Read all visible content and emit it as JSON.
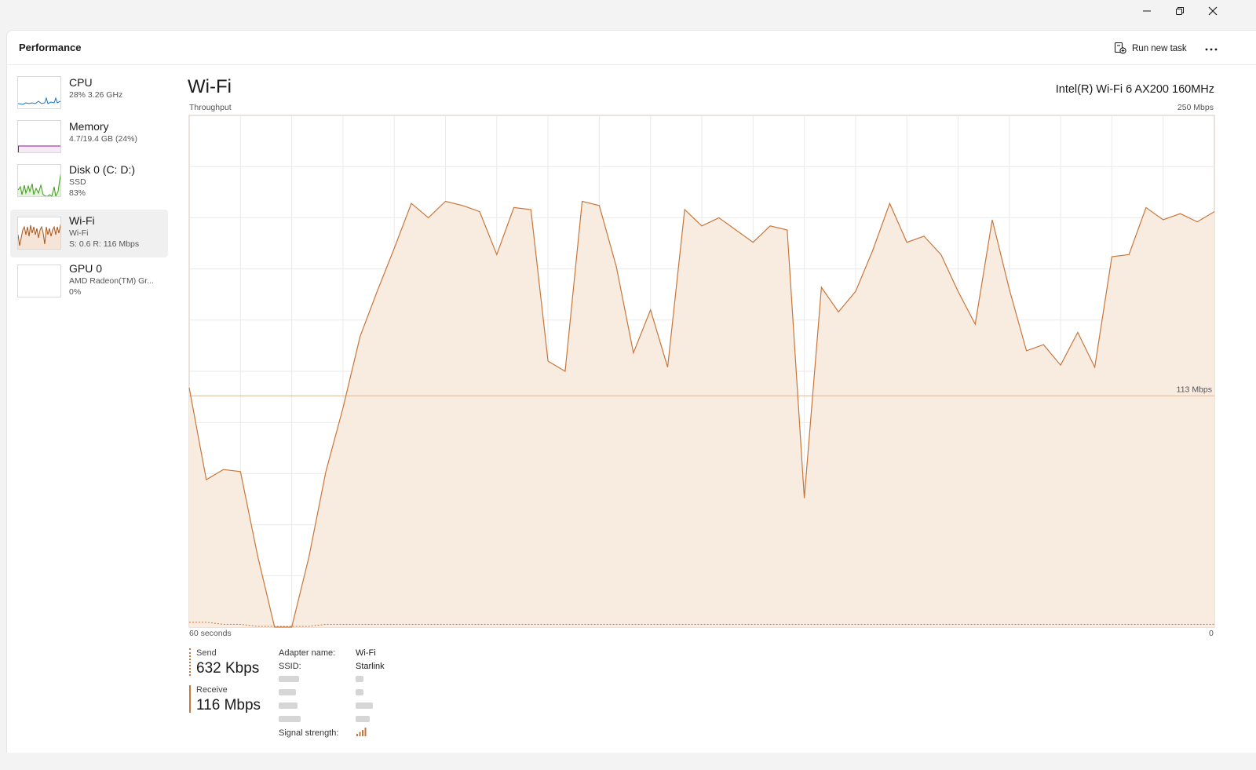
{
  "window": {
    "controls": {
      "minimize_icon": "minimize-icon",
      "maximize_icon": "restore-icon",
      "close_icon": "close-icon"
    }
  },
  "header": {
    "title": "Performance",
    "run_new_task": "Run new task",
    "more_icon": "more-icon"
  },
  "sidebar": {
    "items": [
      {
        "name": "CPU",
        "sub1": "28%  3.26 GHz",
        "sub2": "",
        "color": "#1a73c7"
      },
      {
        "name": "Memory",
        "sub1": "4.7/19.4 GB (24%)",
        "sub2": "",
        "color": "#8b1a8b"
      },
      {
        "name": "Disk 0 (C: D:)",
        "sub1": "SSD",
        "sub2": "83%",
        "color": "#3f9a1c"
      },
      {
        "name": "Wi-Fi",
        "sub1": "Wi-Fi",
        "sub2": "S: 0.6  R: 116 Mbps",
        "color": "#a7561b"
      },
      {
        "name": "GPU 0",
        "sub1": "AMD Radeon(TM) Gr...",
        "sub2": "0%",
        "color": "#1a73c7"
      }
    ]
  },
  "main": {
    "title": "Wi-Fi",
    "adapter_model": "Intel(R) Wi-Fi 6 AX200 160MHz",
    "throughput_label": "Throughput",
    "max_label": "250 Mbps",
    "time_label": "60 seconds",
    "zero_label": "0",
    "scale_line_label": "113 Mbps"
  },
  "chart_data": {
    "type": "area",
    "title": "Throughput",
    "xlabel": "60 seconds",
    "ylabel": "",
    "xlim": [
      60,
      0
    ],
    "ylim": [
      0,
      250
    ],
    "grid": true,
    "reference_line": 113,
    "x": [
      60,
      59,
      58,
      57,
      56,
      55,
      54,
      53,
      52,
      51,
      50,
      49,
      48,
      47,
      46,
      45,
      44,
      43,
      42,
      41,
      40,
      39,
      38,
      37,
      36,
      35,
      34,
      33,
      32,
      31,
      30,
      29,
      28,
      27,
      26,
      25,
      24,
      23,
      22,
      21,
      20,
      19,
      18,
      17,
      16,
      15,
      14,
      13,
      12,
      11,
      10,
      9,
      8,
      7,
      6,
      5,
      4,
      3,
      2,
      1,
      0
    ],
    "series": [
      {
        "name": "Receive",
        "style": "solid",
        "color": "#c8763a",
        "values": [
          117,
          72,
          77,
          76,
          35,
          0,
          0,
          34,
          76,
          107,
          142,
          164,
          185,
          207,
          200,
          208,
          206,
          203,
          182,
          205,
          204,
          130,
          125,
          208,
          206,
          176,
          134,
          155,
          127,
          204,
          196,
          200,
          194,
          188,
          196,
          194,
          63,
          166,
          154,
          164,
          184,
          207,
          188,
          191,
          182,
          164,
          148,
          199,
          165,
          135,
          138,
          128,
          144,
          127,
          181,
          182,
          205,
          199,
          202,
          198,
          203
        ]
      },
      {
        "name": "Send",
        "style": "dotted",
        "color": "#c8763a",
        "values": [
          2,
          2,
          1,
          1,
          0,
          0,
          0,
          0,
          1,
          1,
          1,
          1,
          1,
          1,
          1,
          1,
          1,
          1,
          1,
          1,
          1,
          1,
          1,
          1,
          1,
          1,
          1,
          1,
          1,
          1,
          1,
          1,
          1,
          1,
          1,
          1,
          1,
          1,
          1,
          1,
          1,
          1,
          1,
          1,
          1,
          1,
          1,
          1,
          1,
          1,
          1,
          1,
          1,
          1,
          1,
          1,
          1,
          1,
          1,
          1,
          1
        ]
      }
    ]
  },
  "stats": {
    "send_label": "Send",
    "send_value": "632 Kbps",
    "receive_label": "Receive",
    "receive_value": "116 Mbps"
  },
  "properties": {
    "adapter_name_label": "Adapter name:",
    "adapter_name_value": "Wi-Fi",
    "ssid_label": "SSID:",
    "ssid_value": "Starlink",
    "signal_label": "Signal strength:",
    "signal_icon": "signal-strength-icon"
  }
}
